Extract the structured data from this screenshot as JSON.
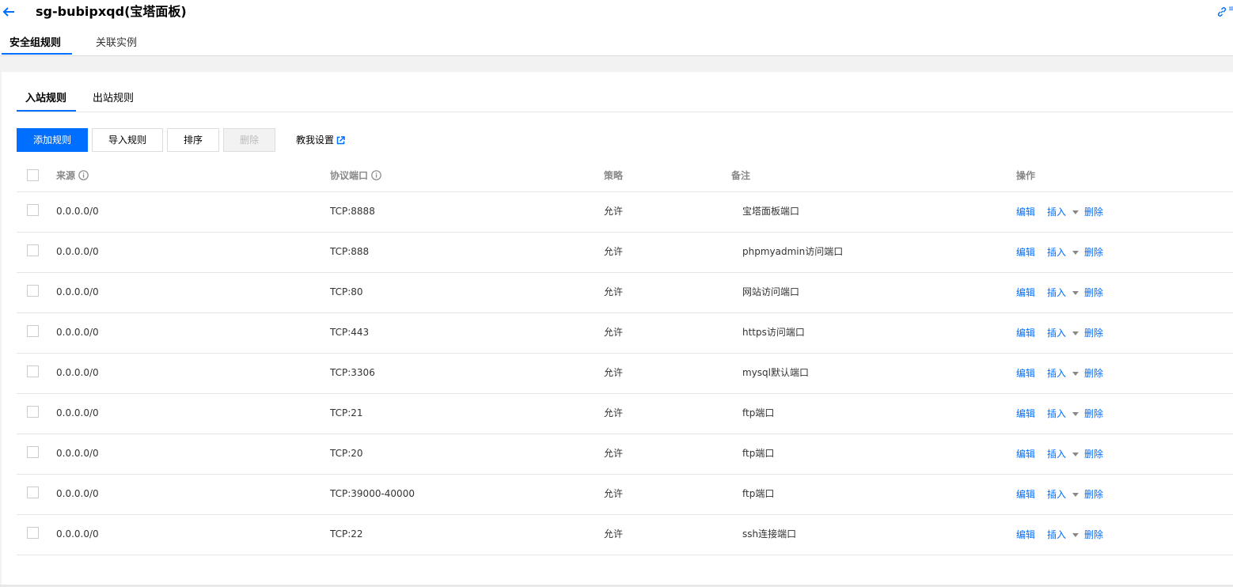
{
  "header": {
    "title": "sg-bubipxqd(宝塔面板)",
    "edge_glyph": "≡"
  },
  "top_tabs": [
    {
      "label": "安全组规则",
      "active": true
    },
    {
      "label": "关联实例",
      "active": false
    }
  ],
  "inner_tabs": [
    {
      "label": "入站规则",
      "active": true
    },
    {
      "label": "出站规则",
      "active": false
    }
  ],
  "toolbar": {
    "add_label": "添加规则",
    "import_label": "导入规则",
    "sort_label": "排序",
    "delete_label": "删除",
    "help_label": "教我设置"
  },
  "table": {
    "columns": {
      "source": "来源",
      "protocol_port": "协议端口",
      "policy": "策略",
      "remark": "备注",
      "actions": "操作"
    },
    "row_actions": {
      "edit": "编辑",
      "insert": "插入",
      "delete": "删除"
    },
    "rows": [
      {
        "source": "0.0.0.0/0",
        "port": "TCP:8888",
        "policy": "允许",
        "remark": "宝塔面板端口"
      },
      {
        "source": "0.0.0.0/0",
        "port": "TCP:888",
        "policy": "允许",
        "remark": "phpmyadmin访问端口"
      },
      {
        "source": "0.0.0.0/0",
        "port": "TCP:80",
        "policy": "允许",
        "remark": "网站访问端口"
      },
      {
        "source": "0.0.0.0/0",
        "port": "TCP:443",
        "policy": "允许",
        "remark": "https访问端口"
      },
      {
        "source": "0.0.0.0/0",
        "port": "TCP:3306",
        "policy": "允许",
        "remark": "mysql默认端口"
      },
      {
        "source": "0.0.0.0/0",
        "port": "TCP:21",
        "policy": "允许",
        "remark": "ftp端口"
      },
      {
        "source": "0.0.0.0/0",
        "port": "TCP:20",
        "policy": "允许",
        "remark": "ftp端口"
      },
      {
        "source": "0.0.0.0/0",
        "port": "TCP:39000-40000",
        "policy": "允许",
        "remark": "ftp端口"
      },
      {
        "source": "0.0.0.0/0",
        "port": "TCP:22",
        "policy": "允许",
        "remark": "ssh连接端口"
      }
    ]
  },
  "colors": {
    "accent": "#006eff",
    "border": "#e5e5e5",
    "band": "#f2f2f2"
  }
}
